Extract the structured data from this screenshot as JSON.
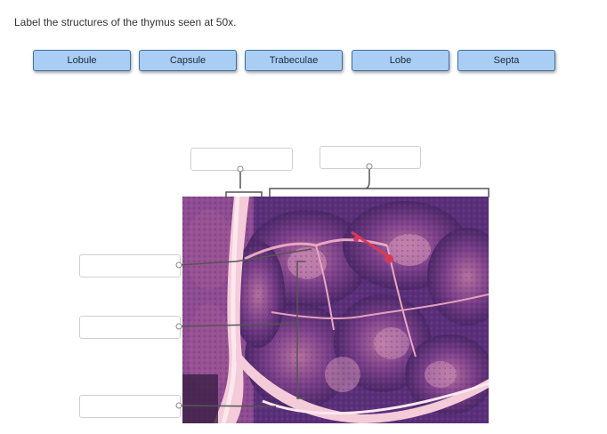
{
  "instruction": "Label the structures of the thymus seen at 50x.",
  "labels": [
    "Lobule",
    "Capsule",
    "Trabeculae",
    "Lobe",
    "Septa"
  ],
  "colors": {
    "chip_fill": "#a9cdf3",
    "chip_border": "#3d6fa3",
    "tissue_purple": "#5a2f7a",
    "tissue_pink": "#c7688f",
    "septa_pink": "#f2c8d6",
    "leader_line": "#555555"
  }
}
